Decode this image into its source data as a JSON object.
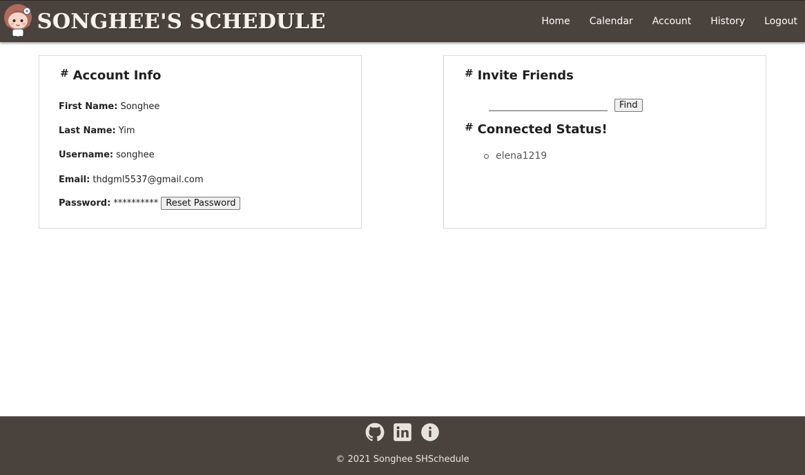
{
  "header": {
    "title": "SONGHEE'S SCHEDULE",
    "logo_icon": "girl-avatar-icon",
    "nav": [
      {
        "label": "Home"
      },
      {
        "label": "Calendar"
      },
      {
        "label": "Account"
      },
      {
        "label": "History"
      },
      {
        "label": "Logout"
      }
    ]
  },
  "account_info": {
    "heading": "Account Info",
    "fields": [
      {
        "label": "First Name:",
        "value": "Songhee"
      },
      {
        "label": "Last Name:",
        "value": "Yim"
      },
      {
        "label": "Username:",
        "value": "songhee"
      },
      {
        "label": "Email:",
        "value": "thdgml5537@gmail.com"
      },
      {
        "label": "Password:",
        "value": "**********"
      }
    ],
    "reset_label": "Reset Password"
  },
  "invite": {
    "heading": "Invite Friends",
    "input_value": "",
    "input_placeholder": "",
    "find_label": "Find"
  },
  "connected": {
    "heading": "Connected Status!",
    "friends": [
      "elena1219"
    ]
  },
  "footer": {
    "icons": [
      "github-icon",
      "linkedin-icon",
      "info-icon"
    ],
    "copyright": "© 2021 Songhee SHSchedule"
  },
  "colors": {
    "header_bg": "#4a423d",
    "footer_bg": "#4a423d"
  }
}
